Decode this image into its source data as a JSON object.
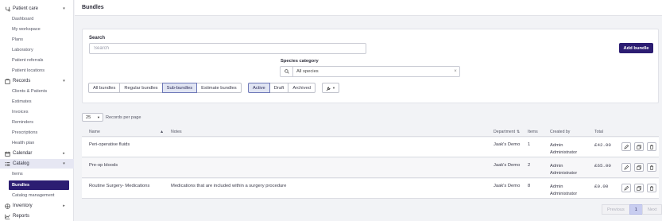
{
  "sidebar": {
    "sections": [
      {
        "label": "Patient care",
        "icon": "stethoscope-icon",
        "chevron": "▾"
      },
      {
        "label": "Records",
        "icon": "records-icon",
        "chevron": "▾"
      },
      {
        "label": "Calendar",
        "icon": "calendar-icon",
        "chevron": "▸"
      },
      {
        "label": "Catalog",
        "icon": "catalog-icon",
        "chevron": "▾"
      },
      {
        "label": "Inventory",
        "icon": "inventory-icon",
        "chevron": "▸"
      },
      {
        "label": "Reports",
        "icon": "reports-icon",
        "chevron": ""
      }
    ],
    "patient_care_items": [
      "Dashboard",
      "My workspace",
      "Plans",
      "Laboratory",
      "Patient referrals",
      "Patient locations"
    ],
    "records_items": [
      "Clients & Patients",
      "Estimates",
      "Invoices",
      "Reminders",
      "Prescriptions",
      "Health plan"
    ],
    "catalog_items": [
      "Items",
      "Bundles",
      "Catalog management"
    ],
    "active_item": "Bundles"
  },
  "header": {
    "title": "Bundles"
  },
  "filters": {
    "search_label": "Search",
    "search_placeholder": "Search",
    "search_value": "",
    "add_button": "Add bundle",
    "species_label": "Species category",
    "species_value": "All species",
    "species_clear": "×",
    "type_tabs": [
      "All bundles",
      "Regular bundles",
      "Sub-bundles",
      "Estimate bundles"
    ],
    "type_selected": "Sub-bundles",
    "status_tabs": [
      "Active",
      "Draft",
      "Archived"
    ],
    "status_selected": "Active"
  },
  "records_per_page": {
    "value": "25",
    "label": "Records per page"
  },
  "table": {
    "columns": {
      "name": "Name",
      "notes": "Notes",
      "department": "Department",
      "items": "Items",
      "created_by": "Created by",
      "total": "Total"
    },
    "rows": [
      {
        "name": "Peri-operative fluids",
        "notes": "",
        "department": "Jaak's Demo",
        "items": "1",
        "created_by": "Admin Administrator",
        "total": "£42.00"
      },
      {
        "name": "Pre-op bloods",
        "notes": "",
        "department": "Jaak's Demo",
        "items": "2",
        "created_by": "Admin Administrator",
        "total": "£65.00"
      },
      {
        "name": "Routine Surgery- Medications",
        "notes": "Medications that are included within a surgery procedure",
        "department": "Jaak's Demo",
        "items": "8",
        "created_by": "Admin Administrator",
        "total": "£0.00"
      }
    ]
  },
  "pagination": {
    "previous": "Previous",
    "current": "1",
    "next": "Next"
  },
  "colors": {
    "brand": "#2c1d72",
    "selected_tab": "#e1e5f3",
    "current_page": "#c8cdf0"
  }
}
